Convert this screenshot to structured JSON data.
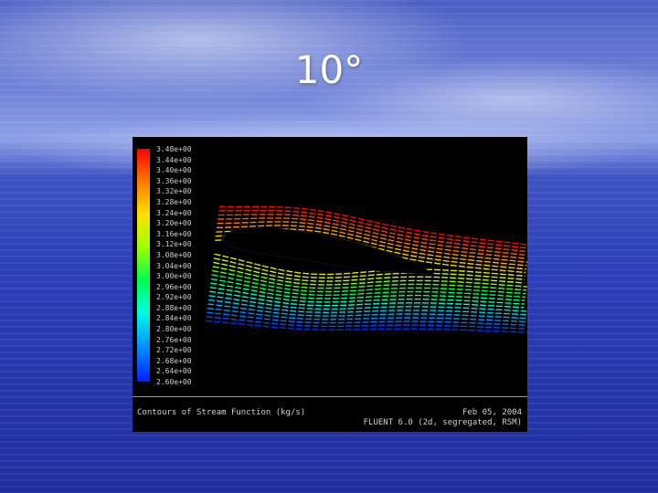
{
  "slide": {
    "title": "10°"
  },
  "figure": {
    "legend_labels": [
      "3.48e+00",
      "3.44e+00",
      "3.40e+00",
      "3.36e+00",
      "3.32e+00",
      "3.28e+00",
      "3.24e+00",
      "3.20e+00",
      "3.16e+00",
      "3.12e+00",
      "3.08e+00",
      "3.04e+00",
      "3.00e+00",
      "2.96e+00",
      "2.92e+00",
      "2.88e+00",
      "2.84e+00",
      "2.80e+00",
      "2.76e+00",
      "2.72e+00",
      "2.68e+00",
      "2.64e+00",
      "2.60e+00"
    ],
    "colormap": [
      "#ff0000",
      "#ff6a00",
      "#ffcc00",
      "#c8ff00",
      "#00ff3a",
      "#00ffd0",
      "#00a0ff",
      "#0030ff"
    ],
    "caption": "Contours of Stream Function (kg/s)",
    "date": "Feb 05, 2004",
    "solver": "FLUENT 6.0 (2d, segregated, RSM)"
  }
}
